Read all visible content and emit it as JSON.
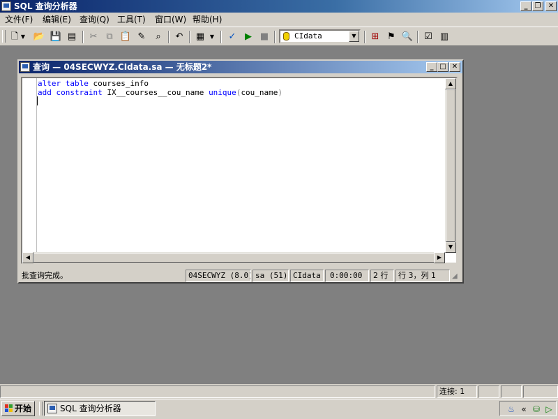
{
  "app": {
    "title": "SQL 查询分析器"
  },
  "menubar": [
    "文件(F)",
    "编辑(E)",
    "查询(Q)",
    "工具(T)",
    "窗口(W)",
    "帮助(H)"
  ],
  "toolbar": {
    "database": "CIdata",
    "icons": [
      "new-query-icon",
      "open-icon",
      "save-icon",
      "load-script-icon",
      "cut-icon",
      "copy-icon",
      "paste-icon",
      "clear-window-icon",
      "find-icon",
      "undo-icon",
      "results-grid-icon",
      "parse-query-icon",
      "execute-icon",
      "cancel-query-icon",
      "object-browser-icon",
      "object-search-icon",
      "show-plan-icon",
      "properties-icon",
      "results-pane-icon"
    ]
  },
  "query_window": {
    "title": "查询 — 04SECWYZ.CIdata.sa — 无标题2*",
    "code": [
      [
        {
          "t": "alter",
          "c": "kw"
        },
        {
          "t": " ",
          "c": "tx"
        },
        {
          "t": "table",
          "c": "kw"
        },
        {
          "t": " courses_info",
          "c": "tx"
        }
      ],
      [
        {
          "t": "add",
          "c": "kw"
        },
        {
          "t": " ",
          "c": "tx"
        },
        {
          "t": "constraint",
          "c": "kw"
        },
        {
          "t": " IX__courses__cou_name ",
          "c": "tx"
        },
        {
          "t": "unique",
          "c": "kw"
        },
        {
          "t": "(",
          "c": "gray"
        },
        {
          "t": "cou_name",
          "c": "tx"
        },
        {
          "t": ")",
          "c": "gray"
        }
      ]
    ],
    "status": {
      "message": "批查询完成。",
      "server": "04SECWYZ (8.0)",
      "user": "sa (51)",
      "database": "CIdata",
      "elapsed": "0:00:00",
      "rows": "2 行",
      "position": "行 3，列 1"
    }
  },
  "app_status": {
    "connections": "连接: 1"
  },
  "taskbar": {
    "start_label": "开始",
    "task_label": "SQL 查询分析器"
  }
}
